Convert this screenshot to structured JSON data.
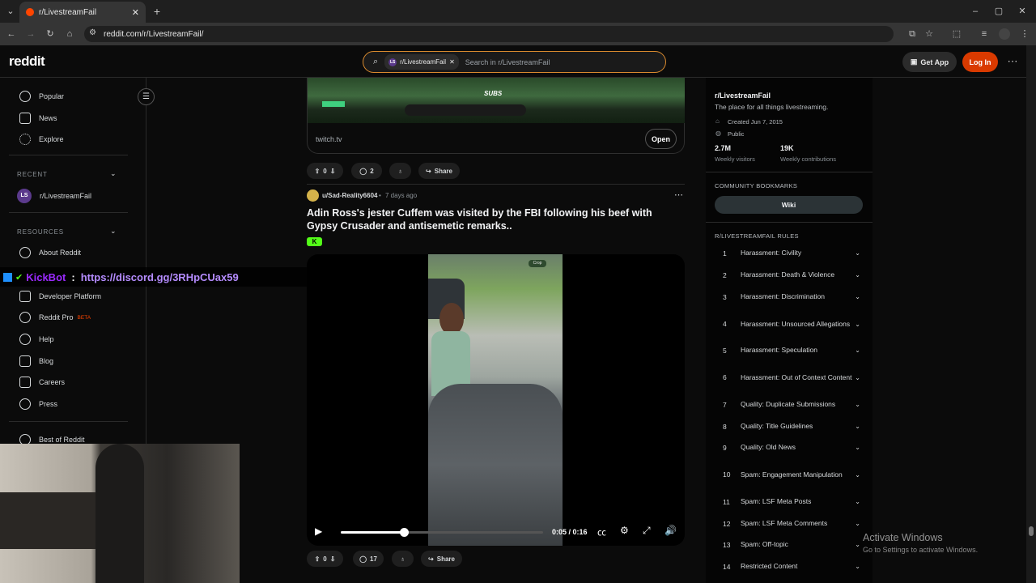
{
  "browser": {
    "tab_title": "r/LivestreamFail",
    "url": "reddit.com/r/LivestreamFail/"
  },
  "header": {
    "logo": "reddit",
    "search_chip": "r/LivestreamFail",
    "search_placeholder": "Search in r/LivestreamFail",
    "get_app": "Get App",
    "login": "Log In"
  },
  "sidebar": {
    "top_items": [
      "Popular",
      "News",
      "Explore"
    ],
    "recent_label": "RECENT",
    "recent_items": [
      "r/LivestreamFail"
    ],
    "resources_label": "RESOURCES",
    "resource_items": [
      "About Reddit",
      "Developer Platform",
      "Reddit Pro",
      "Help",
      "Blog",
      "Careers",
      "Press"
    ],
    "reddit_pro_badge": "BETA",
    "best_of": "Best of Reddit"
  },
  "overlay": {
    "bot_name": "KickBot",
    "separator": ":",
    "link": "https://discord.gg/3RHpCUax59"
  },
  "feed": {
    "prev_post": {
      "domain": "twitch.tv",
      "open_label": "Open",
      "thumb_text": "SUBS",
      "votes": "0",
      "comments": "2",
      "share": "Share"
    },
    "post": {
      "author": "u/Sad-Reality6604",
      "age": "7 days ago",
      "title": "Adin Ross's jester Cuffem was visited by the FBI following his beef with Gypsy Crusader and antisemetic remarks..",
      "flair": "K",
      "crop_label": "Crop",
      "time": "0:05 / 0:16",
      "progress": 0.31,
      "votes": "0",
      "comments": "17",
      "share": "Share"
    }
  },
  "community": {
    "name": "r/LivestreamFail",
    "description": "The place for all things livestreaming.",
    "created": "Created Jun 7, 2015",
    "visibility": "Public",
    "visitors": "2.7M",
    "visitors_label": "Weekly visitors",
    "contributions": "19K",
    "contributions_label": "Weekly contributions",
    "bookmarks_label": "COMMUNITY BOOKMARKS",
    "wiki": "Wiki",
    "rules_label": "R/LIVESTREAMFAIL RULES",
    "rules": [
      {
        "n": "1",
        "t": "Harassment: Civility"
      },
      {
        "n": "2",
        "t": "Harassment: Death & Violence"
      },
      {
        "n": "3",
        "t": "Harassment: Discrimination"
      },
      {
        "n": "4",
        "t": "Harassment: Unsourced Allegations"
      },
      {
        "n": "5",
        "t": "Harassment: Speculation"
      },
      {
        "n": "6",
        "t": "Harassment: Out of Context Content"
      },
      {
        "n": "7",
        "t": "Quality: Duplicate Submissions"
      },
      {
        "n": "8",
        "t": "Quality: Title Guidelines"
      },
      {
        "n": "9",
        "t": "Quality: Old News"
      },
      {
        "n": "10",
        "t": "Spam: Engagement Manipulation"
      },
      {
        "n": "11",
        "t": "Spam: LSF Meta Posts"
      },
      {
        "n": "12",
        "t": "Spam: LSF Meta Comments"
      },
      {
        "n": "13",
        "t": "Spam: Off-topic"
      },
      {
        "n": "14",
        "t": "Restricted Content"
      }
    ]
  },
  "watermark": {
    "title": "Activate Windows",
    "subtitle": "Go to Settings to activate Windows."
  }
}
